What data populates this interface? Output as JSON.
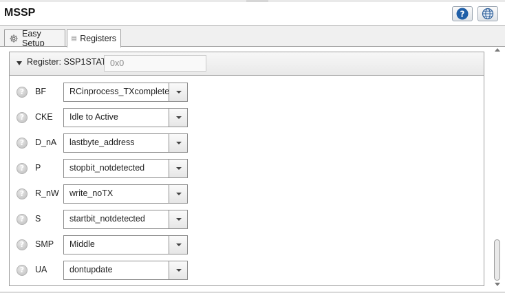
{
  "app": {
    "title": "MSSP"
  },
  "toolbar": {
    "help_icon": "help-icon",
    "globe_icon": "globe-icon"
  },
  "tabs": [
    {
      "label": "Easy Setup",
      "icon": "gear-icon",
      "active": false
    },
    {
      "label": "Registers",
      "icon": "table-icon",
      "active": true
    }
  ],
  "register": {
    "label": "Register: SSP1STAT",
    "value_placeholder": "0x0",
    "fields": [
      {
        "name": "BF",
        "value": "RCinprocess_TXcomplete"
      },
      {
        "name": "CKE",
        "value": "Idle to Active"
      },
      {
        "name": "D_nA",
        "value": "lastbyte_address"
      },
      {
        "name": "P",
        "value": "stopbit_notdetected"
      },
      {
        "name": "R_nW",
        "value": "write_noTX"
      },
      {
        "name": "S",
        "value": "startbit_notdetected"
      },
      {
        "name": "SMP",
        "value": "Middle"
      },
      {
        "name": "UA",
        "value": "dontupdate"
      }
    ]
  },
  "colors": {
    "accent": "#1f5fa8",
    "panel_border": "#9d9d9d"
  }
}
